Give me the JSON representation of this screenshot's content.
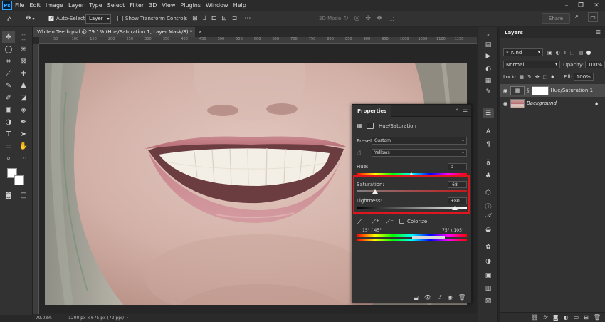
{
  "menubar": {
    "logo": "Ps",
    "items": [
      "File",
      "Edit",
      "Image",
      "Layer",
      "Type",
      "Select",
      "Filter",
      "3D",
      "View",
      "Plugins",
      "Window",
      "Help"
    ]
  },
  "options": {
    "auto_select_label": "Auto-Select:",
    "auto_select_value": "Layer",
    "show_transform_label": "Show Transform Controls",
    "mode_3d_label": "3D Mode:",
    "share_label": "Share"
  },
  "document": {
    "tab_title": "Whiten Teeth.psd @ 79.1% (Hue/Saturation 1, Layer Mask/8) *",
    "close_glyph": "×",
    "zoom": "79.08%",
    "dimensions": "1200 px x 675 px (72 ppi)",
    "ruler_numbers": [
      "50",
      "100",
      "150",
      "200",
      "250",
      "300",
      "350",
      "400",
      "450",
      "500",
      "550",
      "600",
      "650",
      "700",
      "750",
      "800",
      "850",
      "900",
      "950",
      "1000",
      "1050",
      "1100",
      "1150"
    ]
  },
  "properties": {
    "tab_label": "Properties",
    "adjustment_name": "Hue/Saturation",
    "preset_label": "Preset:",
    "preset_value": "Custom",
    "range_value": "Yellows",
    "hue_label": "Hue:",
    "hue_value": "0",
    "saturation_label": "Saturation:",
    "saturation_value": "-68",
    "lightness_label": "Lightness:",
    "lightness_value": "+80",
    "colorize_label": "Colorize",
    "range_left": "15° / 45°",
    "range_right": "75° \\ 105°"
  },
  "layers": {
    "tab_label": "Layers",
    "kind_label": "Kind",
    "blend_mode": "Normal",
    "opacity_label": "Opacity:",
    "opacity_value": "100%",
    "lock_label": "Lock:",
    "fill_label": "Fill:",
    "fill_value": "100%",
    "items": [
      {
        "name": "Hue/Saturation 1",
        "selected": true
      },
      {
        "name": "Background",
        "selected": false
      }
    ]
  },
  "colors": {
    "highlight": "#e0161f",
    "foreground_swatch": "#ffffff",
    "background_swatch": "#ffffff"
  }
}
